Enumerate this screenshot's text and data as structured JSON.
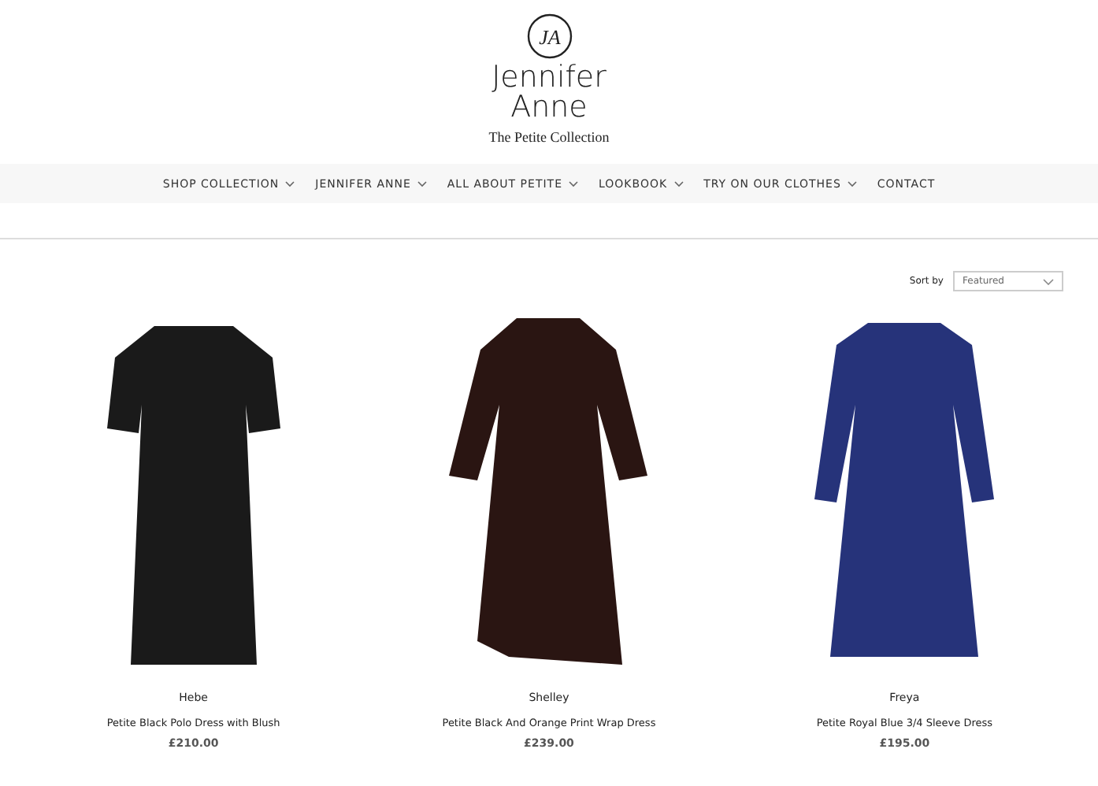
{
  "logo": {
    "monogram": "JA",
    "name_line_1": "Jennifer",
    "name_line_2": "Anne",
    "tagline": "The Petite Collection"
  },
  "nav": [
    {
      "label": "SHOP COLLECTION",
      "dropdown": true
    },
    {
      "label": "JENNIFER ANNE",
      "dropdown": true
    },
    {
      "label": "ALL ABOUT PETITE",
      "dropdown": true
    },
    {
      "label": "LOOKBOOK",
      "dropdown": true
    },
    {
      "label": "TRY ON OUR CLOTHES",
      "dropdown": true
    },
    {
      "label": "CONTACT",
      "dropdown": false
    }
  ],
  "sort": {
    "label": "Sort by",
    "value": "Featured"
  },
  "products": [
    {
      "name": "Hebe",
      "title": "Petite Black Polo Dress with Blush",
      "price": "£210.00",
      "color": "#1a1a1a"
    },
    {
      "name": "Shelley",
      "title": "Petite Black And Orange Print Wrap Dress",
      "price": "£239.00",
      "color": "#2a1512"
    },
    {
      "name": "Freya",
      "title": "Petite Royal Blue 3/4 Sleeve Dress",
      "price": "£195.00",
      "color": "#26337a"
    }
  ]
}
